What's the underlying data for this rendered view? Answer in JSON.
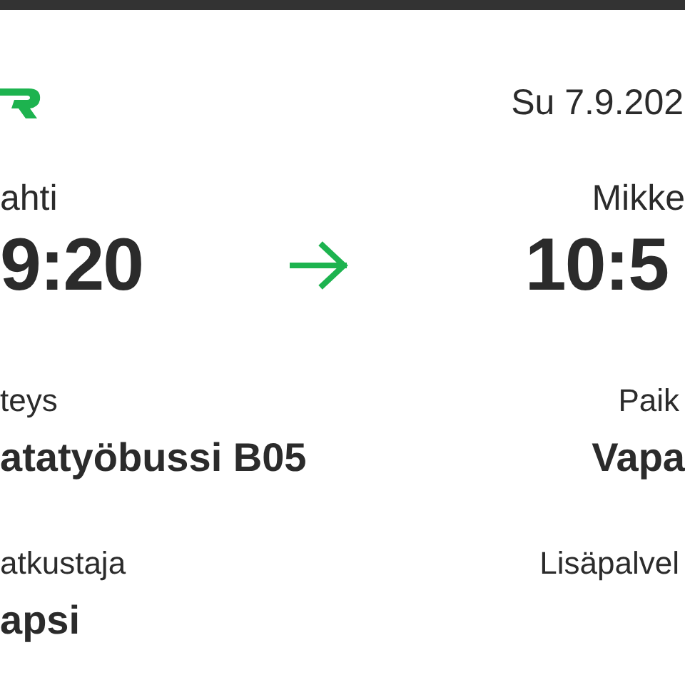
{
  "header": {
    "date": "Su 7.9.202"
  },
  "route": {
    "from": {
      "station": "ahti",
      "time": "9:20"
    },
    "to": {
      "station": "Mikke",
      "time": "10:5"
    }
  },
  "details": [
    {
      "left": {
        "label": "teys",
        "value": "atatyöbussi B05"
      },
      "right": {
        "label": "Paik",
        "value": "Vapa"
      }
    },
    {
      "left": {
        "label": "atkustaja",
        "value": "apsi"
      },
      "right": {
        "label": "Lisäpalvel"
      }
    }
  ]
}
